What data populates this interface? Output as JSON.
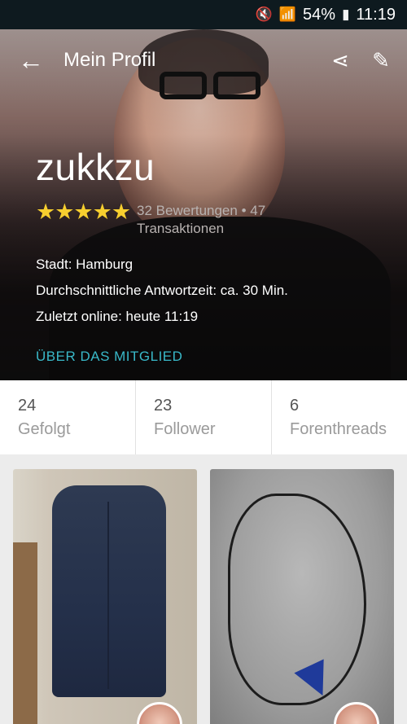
{
  "status_bar": {
    "battery": "54%",
    "time": "11:19"
  },
  "toolbar": {
    "title": "Mein Profil"
  },
  "profile": {
    "username": "zukkzu",
    "stars": "★★★★★",
    "rating_text": "32 Bewertungen • 47 Transaktionen",
    "city_line": "Stadt:  Hamburg",
    "response_line": "Durchschnittliche Antwortzeit:  ca. 30 Min.",
    "online_line": "Zuletzt online: heute 11:19",
    "about_link": "ÜBER DAS MITGLIED"
  },
  "stats": [
    {
      "value": "24",
      "label": "Gefolgt"
    },
    {
      "value": "23",
      "label": "Follower"
    },
    {
      "value": "6",
      "label": "Forenthreads"
    }
  ],
  "colors": {
    "accent": "#39b8c8",
    "star": "#f7cf2f"
  }
}
